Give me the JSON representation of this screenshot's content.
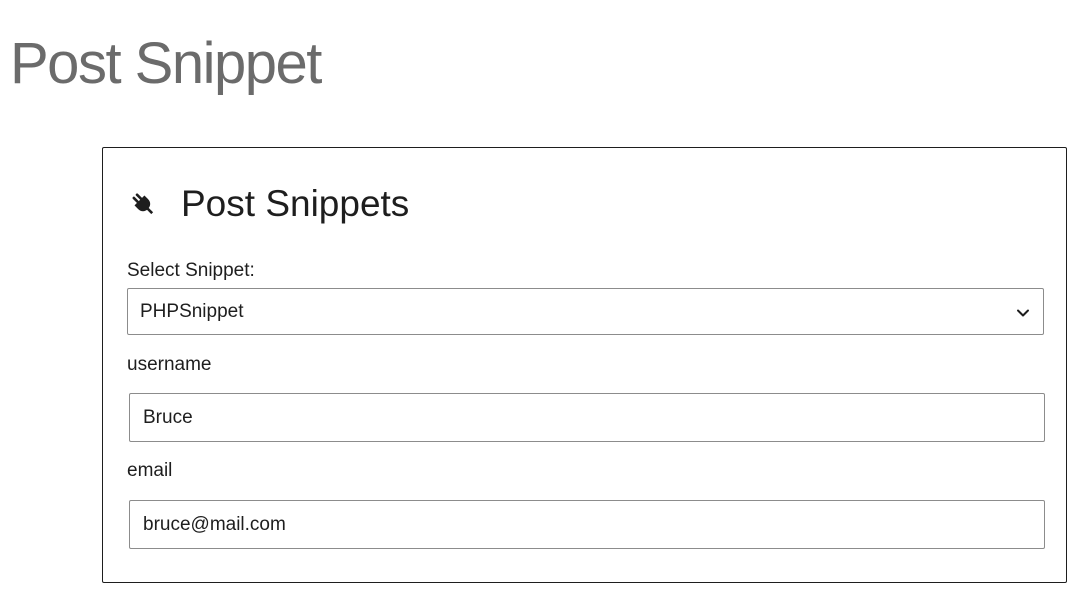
{
  "page": {
    "title": "Post Snippet"
  },
  "block": {
    "icon": "plug-icon",
    "title": "Post Snippets",
    "select": {
      "label": "Select Snippet:",
      "selected": "PHPSnippet",
      "icon": "chevron-down-icon"
    },
    "fields": [
      {
        "label": "username",
        "value": "Bruce"
      },
      {
        "label": "email",
        "value": "bruce@mail.com"
      }
    ]
  },
  "colors": {
    "border": "#1e1e1e",
    "input_border": "#8c8c8c",
    "title_gray": "#6b6b6b"
  }
}
